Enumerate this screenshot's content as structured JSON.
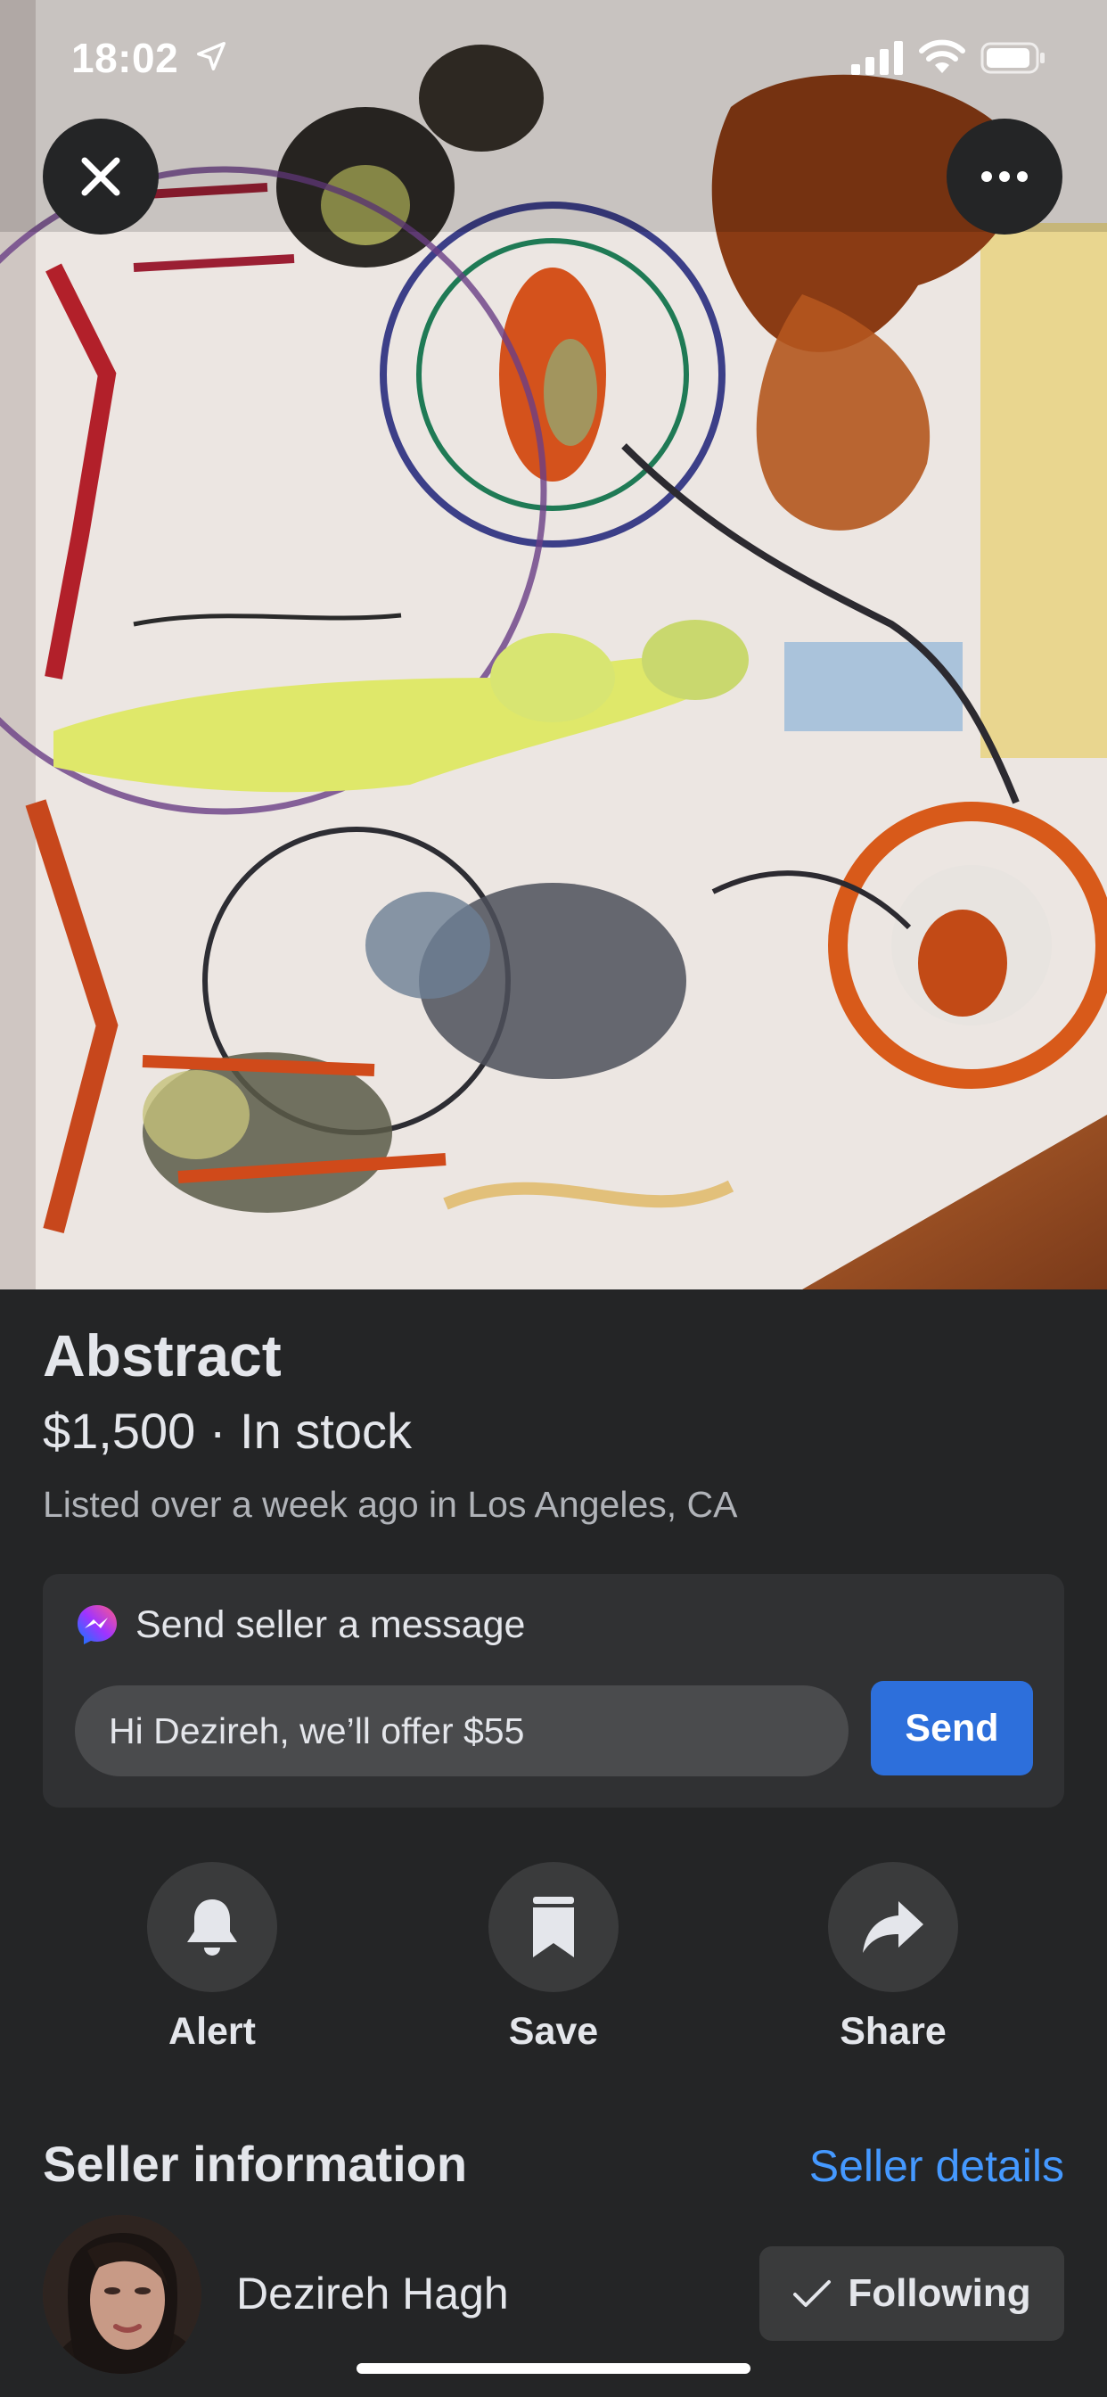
{
  "status_bar": {
    "time": "18:02"
  },
  "listing": {
    "title": "Abstract",
    "price_line": "$1,500 · In stock",
    "listed_text": "Listed over a week ago in Los Angeles, CA"
  },
  "message_card": {
    "header": "Send seller a message",
    "input_value": "Hi Dezireh, we’ll offer $55",
    "send_label": "Send"
  },
  "actions": [
    {
      "label": "Alert",
      "icon": "bell-icon"
    },
    {
      "label": "Save",
      "icon": "bookmark-icon"
    },
    {
      "label": "Share",
      "icon": "share-arrow-icon"
    }
  ],
  "seller": {
    "section_title": "Seller information",
    "details_link": "Seller details",
    "name": "Dezireh Hagh",
    "following_label": "Following"
  },
  "colors": {
    "background": "#242526",
    "card": "#303133",
    "accent_blue": "#2d6fdb",
    "link_blue": "#4599ff"
  }
}
